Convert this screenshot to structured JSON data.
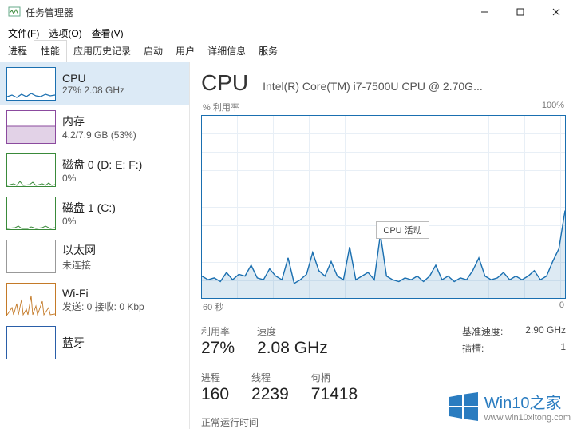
{
  "window": {
    "title": "任务管理器",
    "min": "—",
    "max": "□",
    "close": "✕"
  },
  "menus": {
    "file": "文件(F)",
    "options": "选项(O)",
    "view": "查看(V)"
  },
  "tabs": {
    "processes": "进程",
    "performance": "性能",
    "history": "应用历史记录",
    "startup": "启动",
    "users": "用户",
    "details": "详细信息",
    "services": "服务"
  },
  "sidebar": {
    "cpu": {
      "title": "CPU",
      "sub": "27%  2.08 GHz"
    },
    "mem": {
      "title": "内存",
      "sub": "4.2/7.9 GB (53%)"
    },
    "disk0": {
      "title": "磁盘 0 (D: E: F:)",
      "sub": "0%"
    },
    "disk1": {
      "title": "磁盘 1 (C:)",
      "sub": "0%"
    },
    "eth": {
      "title": "以太网",
      "sub": "未连接"
    },
    "wifi": {
      "title": "Wi-Fi",
      "sub": "发送: 0  接收: 0 Kbp"
    },
    "bt": {
      "title": "蓝牙",
      "sub": ""
    }
  },
  "main": {
    "title": "CPU",
    "model": "Intel(R) Core(TM) i7-7500U CPU @ 2.70G...",
    "ylabel": "% 利用率",
    "ymax": "100%",
    "xleft": "60 秒",
    "xright": "0",
    "tooltip": "CPU 活动"
  },
  "stats": {
    "util_label": "利用率",
    "util": "27%",
    "speed_label": "速度",
    "speed": "2.08 GHz",
    "proc_label": "进程",
    "proc": "160",
    "threads_label": "线程",
    "threads": "2239",
    "handles_label": "句柄",
    "handles": "71418",
    "uptime_label": "正常运行时间"
  },
  "spec": {
    "base_label": "基准速度:",
    "base": "2.90 GHz",
    "sockets_label": "插槽:",
    "sockets": "1"
  },
  "watermark": {
    "main": "Win10之家",
    "sub": "www.win10xitong.com"
  },
  "chart_data": {
    "type": "line",
    "title": "% 利用率",
    "xlabel": "秒",
    "ylabel": "% 利用率",
    "ylim": [
      0,
      100
    ],
    "xlim": [
      60,
      0
    ],
    "values": [
      12,
      10,
      11,
      9,
      14,
      10,
      13,
      12,
      18,
      11,
      10,
      16,
      12,
      10,
      22,
      8,
      10,
      13,
      25,
      15,
      12,
      20,
      12,
      10,
      28,
      10,
      12,
      14,
      10,
      35,
      12,
      10,
      9,
      11,
      10,
      12,
      9,
      12,
      18,
      10,
      12,
      9,
      11,
      10,
      15,
      22,
      12,
      10,
      11,
      14,
      10,
      12,
      10,
      12,
      15,
      10,
      12,
      20,
      27,
      48
    ]
  }
}
